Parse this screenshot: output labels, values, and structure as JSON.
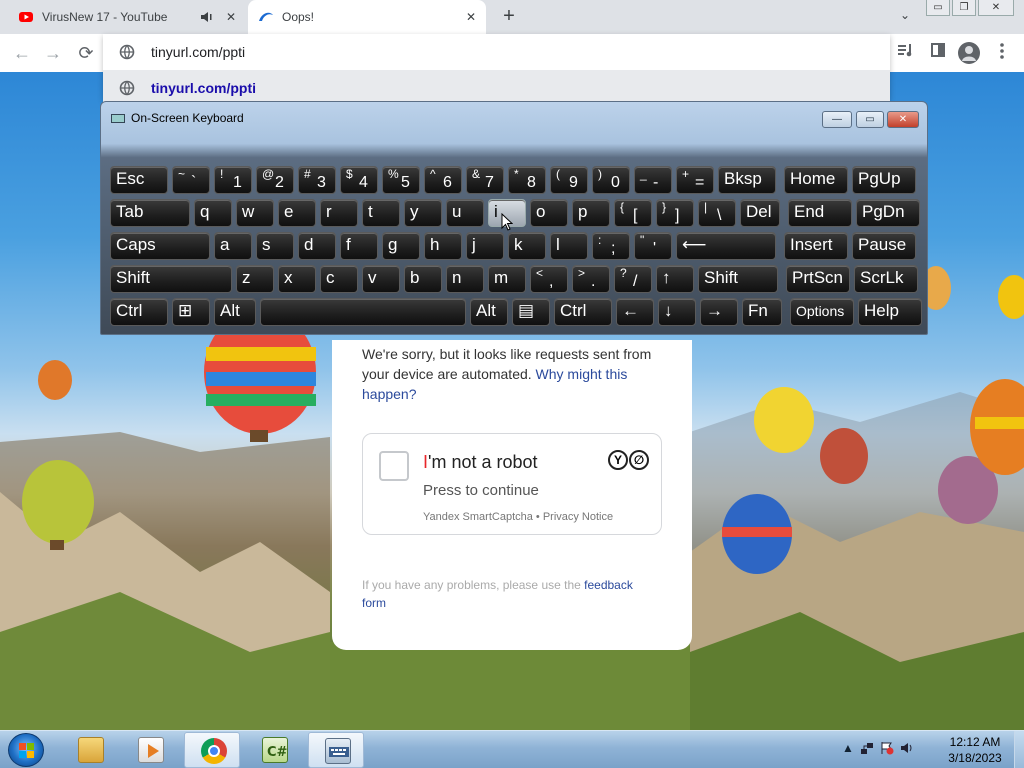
{
  "tabs": [
    {
      "title": "VirusNew 17 - YouTube",
      "icon": "youtube-icon",
      "audio_icon": "speaker-icon",
      "close": "✕"
    },
    {
      "title": "Oops!",
      "icon": "oops-favicon-icon",
      "close": "✕"
    }
  ],
  "tabstrip": {
    "new_tab": "+",
    "tab_search": "⌄"
  },
  "window_controls": {
    "minimize": "▭",
    "restore": "❐",
    "close": "✕"
  },
  "nav": {
    "back": "←",
    "forward": "→",
    "reload": "⟳"
  },
  "omnibox": {
    "value": "tinyurl.com/ppti",
    "suggestion": "tinyurl.com/ppti"
  },
  "toolbar_icons": [
    "media-control-icon",
    "side-panel-icon",
    "profile-icon",
    "menu-icon"
  ],
  "captcha": {
    "message_part": "We're sorry, but it looks like requests sent from your device are automated.",
    "message_link": "Why might this happen?",
    "checkbox_label_red": "I",
    "checkbox_label_rest": "'m not a robot",
    "press": "Press to continue",
    "notice": "Yandex SmartCaptcha • Privacy Notice",
    "logo": [
      "Y",
      "∅"
    ],
    "feedback_text": "If you have any problems, please use the",
    "feedback_link1": "feedback",
    "feedback_link2": "form"
  },
  "osk": {
    "title": "On-Screen Keyboard",
    "buttons": {
      "minimize": "—",
      "restore": "▭",
      "close": "✕"
    },
    "rows": [
      [
        {
          "label": "Esc"
        },
        {
          "sup": "~",
          "main": "`"
        },
        {
          "sup": "!",
          "main": "1"
        },
        {
          "sup": "@",
          "main": "2"
        },
        {
          "sup": "#",
          "main": "3"
        },
        {
          "sup": "$",
          "main": "4"
        },
        {
          "sup": "%",
          "main": "5"
        },
        {
          "sup": "^",
          "main": "6"
        },
        {
          "sup": "&",
          "main": "7"
        },
        {
          "sup": "*",
          "main": "8"
        },
        {
          "sup": "(",
          "main": "9"
        },
        {
          "sup": ")",
          "main": "0"
        },
        {
          "sup": "_",
          "main": "-"
        },
        {
          "sup": "+",
          "main": "="
        },
        {
          "label": "Bksp"
        },
        {
          "label": "Home"
        },
        {
          "label": "PgUp"
        }
      ],
      [
        {
          "label": "Tab"
        },
        {
          "label": "q"
        },
        {
          "label": "w"
        },
        {
          "label": "e"
        },
        {
          "label": "r"
        },
        {
          "label": "t"
        },
        {
          "label": "y"
        },
        {
          "label": "u"
        },
        {
          "label": "i",
          "highlighted": true
        },
        {
          "label": "o"
        },
        {
          "label": "p"
        },
        {
          "sup": "{",
          "main": "["
        },
        {
          "sup": "}",
          "main": "]"
        },
        {
          "sup": "|",
          "main": "\\"
        },
        {
          "label": "Del"
        },
        {
          "label": "End"
        },
        {
          "label": "PgDn"
        }
      ],
      [
        {
          "label": "Caps"
        },
        {
          "label": "a"
        },
        {
          "label": "s"
        },
        {
          "label": "d"
        },
        {
          "label": "f"
        },
        {
          "label": "g"
        },
        {
          "label": "h"
        },
        {
          "label": "j"
        },
        {
          "label": "k"
        },
        {
          "label": "l"
        },
        {
          "sup": ":",
          "main": ";"
        },
        {
          "sup": "\"",
          "main": "'"
        },
        {
          "label": "⟵"
        },
        {
          "label": "Insert"
        },
        {
          "label": "Pause"
        }
      ],
      [
        {
          "label": "Shift"
        },
        {
          "label": "z"
        },
        {
          "label": "x"
        },
        {
          "label": "c"
        },
        {
          "label": "v"
        },
        {
          "label": "b"
        },
        {
          "label": "n"
        },
        {
          "label": "m"
        },
        {
          "sup": "<",
          "main": ","
        },
        {
          "sup": ">",
          "main": "."
        },
        {
          "sup": "?",
          "main": "/"
        },
        {
          "label": "↑"
        },
        {
          "label": "Shift"
        },
        {
          "label": "PrtScn"
        },
        {
          "label": "ScrLk"
        }
      ],
      [
        {
          "label": "Ctrl"
        },
        {
          "label": "⊞"
        },
        {
          "label": "Alt"
        },
        {
          "label": ""
        },
        {
          "label": "Alt"
        },
        {
          "label": "▤"
        },
        {
          "label": "Ctrl"
        },
        {
          "label": "←"
        },
        {
          "label": "↓"
        },
        {
          "label": "→"
        },
        {
          "label": "Fn"
        },
        {
          "label": "Options"
        },
        {
          "label": "Help"
        }
      ]
    ]
  },
  "taskbar": {
    "items": [
      "explorer-icon",
      "media-player-icon",
      "chrome-icon",
      "csharp-icon",
      "osk-icon"
    ],
    "active_index": 4,
    "tray_icons": [
      "show-hidden-icon",
      "network-icon",
      "action-center-icon",
      "volume-icon"
    ],
    "time": "12:12 AM",
    "date": "3/18/2023"
  }
}
